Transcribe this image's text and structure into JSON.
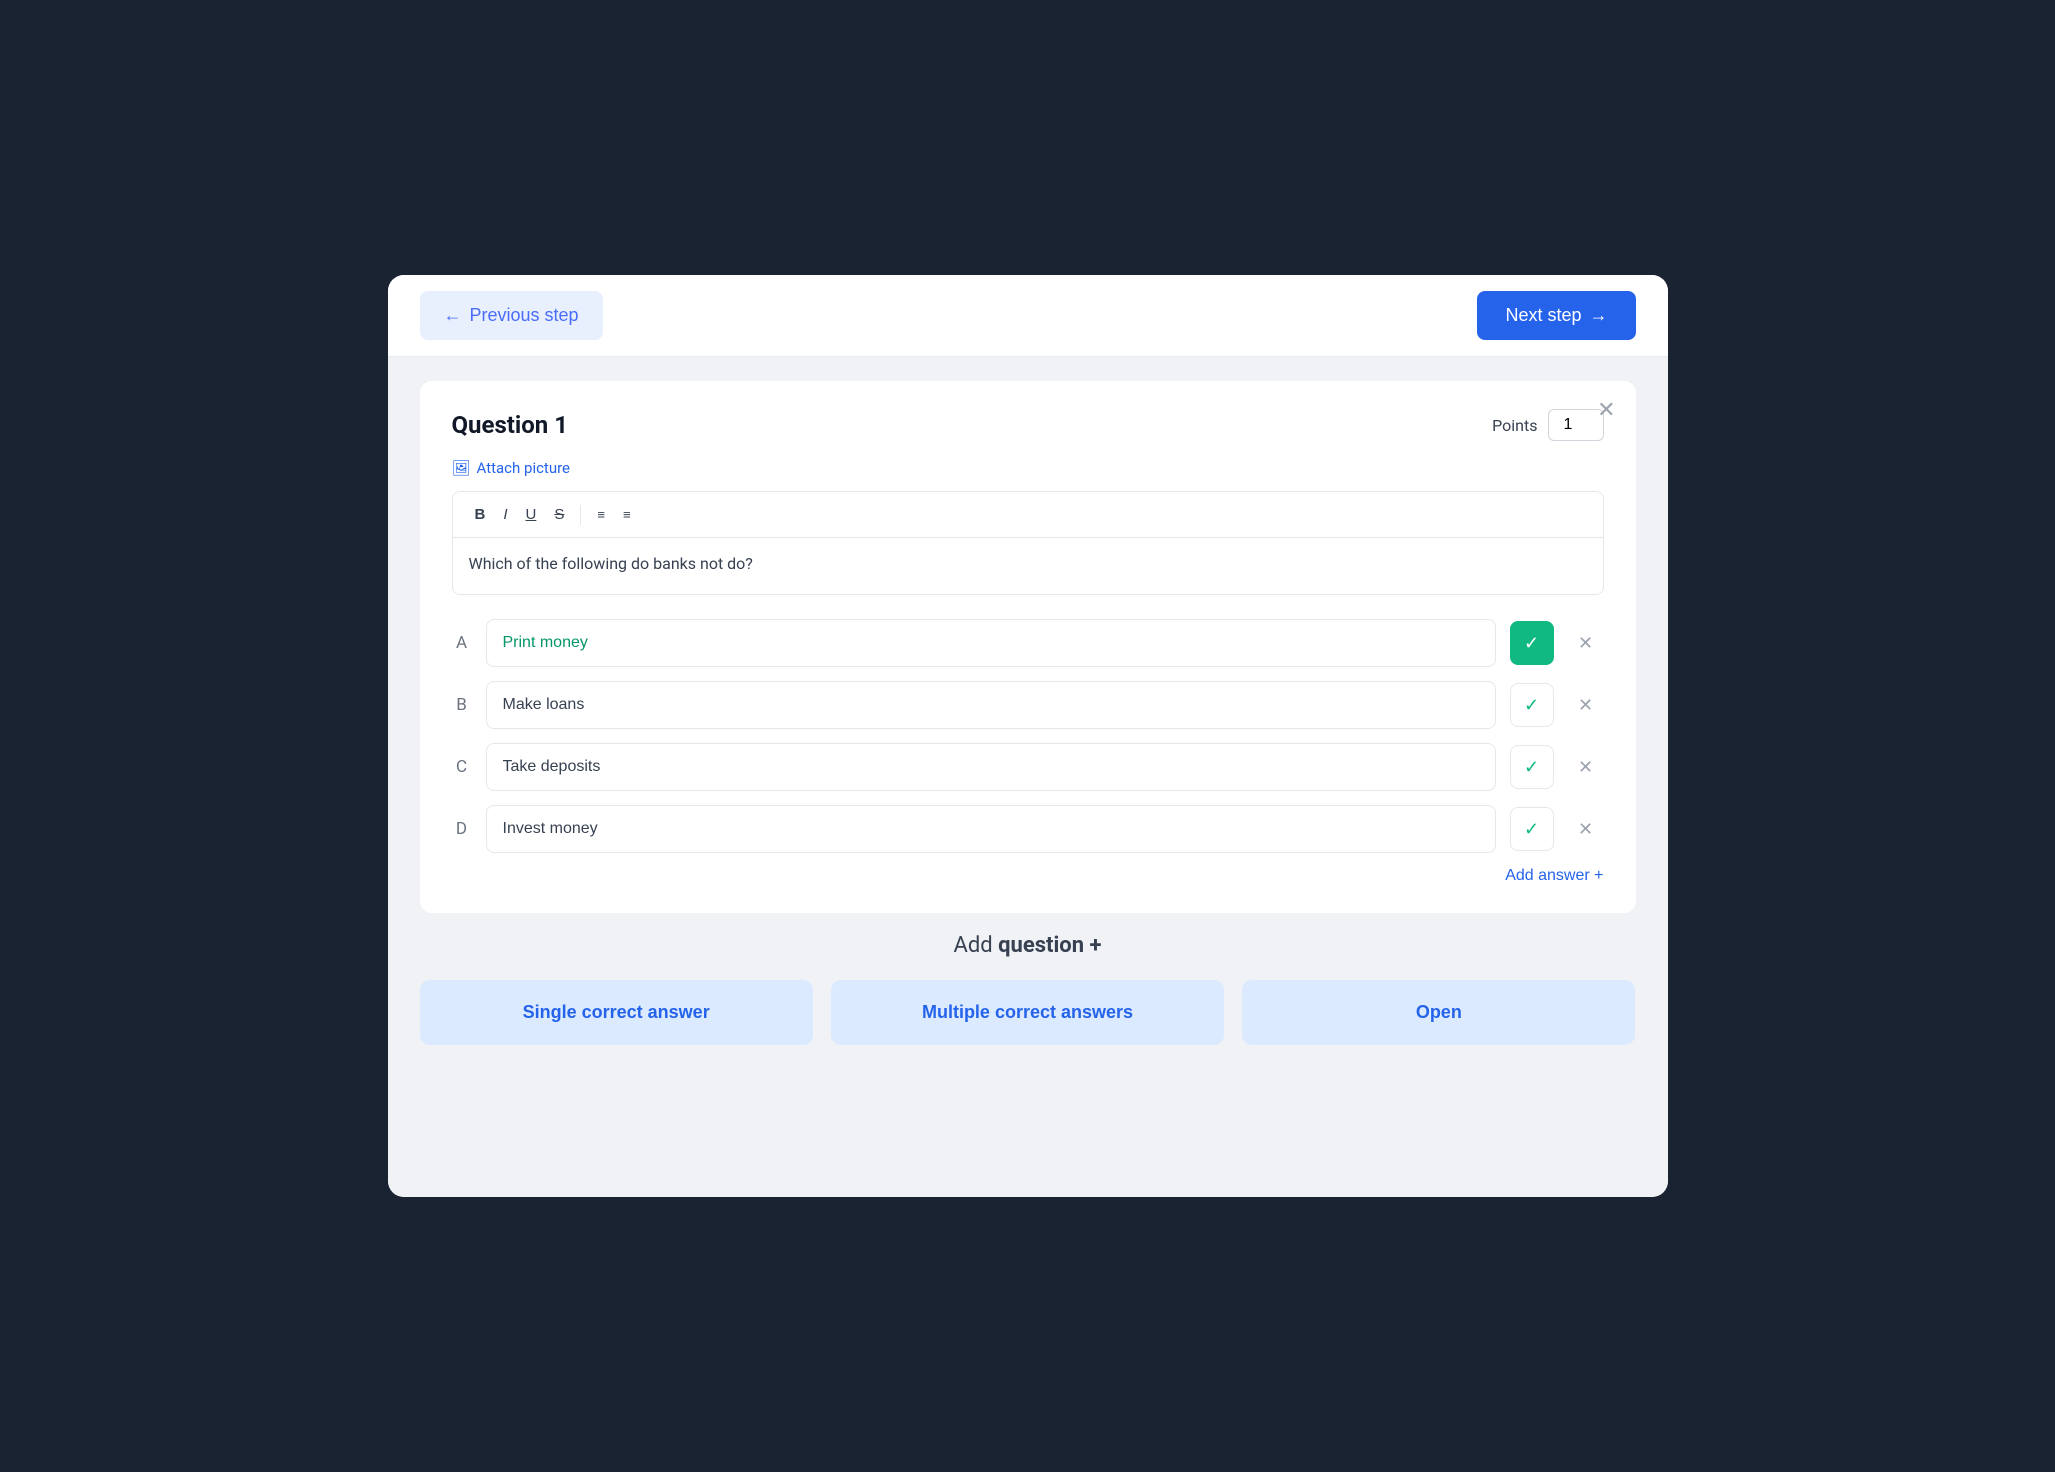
{
  "header": {
    "prev_label": "Previous step",
    "next_label": "Next step"
  },
  "question": {
    "title": "Question 1",
    "points_label": "Points",
    "points_value": "1",
    "attach_label": "Attach picture",
    "question_text": "Which of the following do banks not do?",
    "toolbar": {
      "bold": "B",
      "italic": "I",
      "underline": "U",
      "strikethrough": "S",
      "ordered_list": "≡",
      "unordered_list": "≡"
    }
  },
  "answers": [
    {
      "letter": "A",
      "text": "Print money",
      "correct": true,
      "selected": true
    },
    {
      "letter": "B",
      "text": "Make loans",
      "correct": false,
      "selected": false
    },
    {
      "letter": "C",
      "text": "Take deposits",
      "correct": false,
      "selected": false
    },
    {
      "letter": "D",
      "text": "Invest money",
      "correct": false,
      "selected": false
    }
  ],
  "add_answer": {
    "label": "Add answer +"
  },
  "add_question": {
    "title_plain": "Add ",
    "title_bold": "question +",
    "buttons": [
      {
        "label": "Single correct answer"
      },
      {
        "label": "Multiple correct answers"
      },
      {
        "label": "Open"
      }
    ]
  }
}
